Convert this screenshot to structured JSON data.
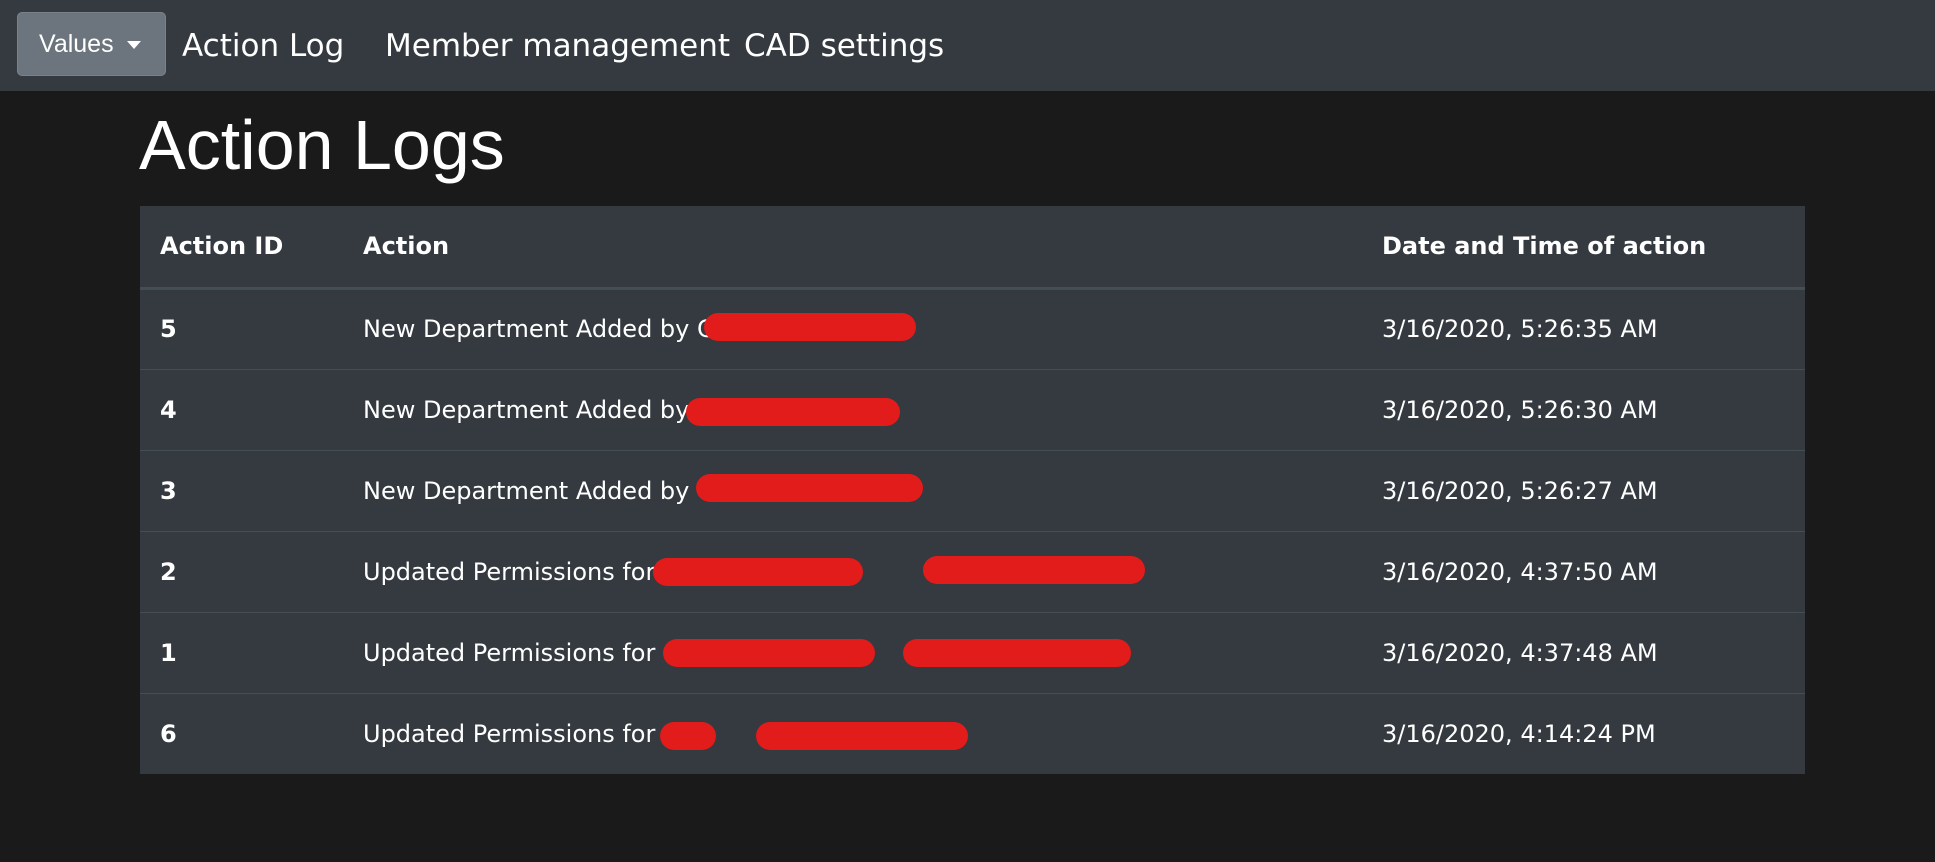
{
  "navbar": {
    "dropdown_label": "Values",
    "links": [
      "Action Log",
      "Member management",
      "CAD settings"
    ]
  },
  "page_title": "Action Logs",
  "table": {
    "headers": [
      "Action ID",
      "Action",
      "Date and Time of action"
    ],
    "rows": [
      {
        "id": "5",
        "action": "New Department Added by C",
        "datetime": "3/16/2020, 5:26:35 AM"
      },
      {
        "id": "4",
        "action": "New Department Added by",
        "datetime": "3/16/2020, 5:26:30 AM"
      },
      {
        "id": "3",
        "action": "New Department Added by",
        "datetime": "3/16/2020, 5:26:27 AM"
      },
      {
        "id": "2",
        "action": "Updated Permissions for",
        "datetime": "3/16/2020, 4:37:50 AM"
      },
      {
        "id": "1",
        "action": "Updated Permissions for",
        "datetime": "3/16/2020, 4:37:48 AM"
      },
      {
        "id": "6",
        "action": "Updated Permissions for",
        "datetime": "3/16/2020, 4:14:24 PM"
      }
    ]
  },
  "colors": {
    "page_background": "#1a1a1a",
    "navbar_background": "#343a40",
    "dropdown_background": "#6c757d",
    "table_background": "#343a40",
    "redaction": "#e21b1b"
  }
}
